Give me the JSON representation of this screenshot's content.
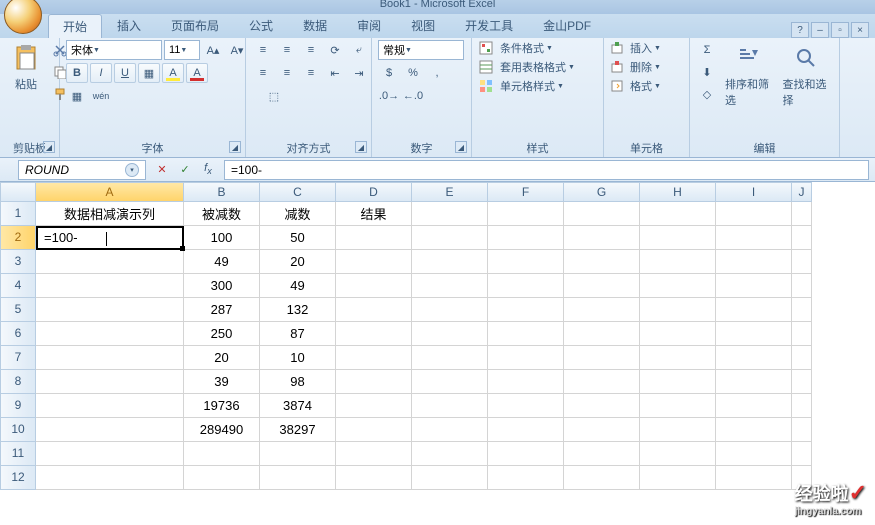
{
  "window_title": "Book1 - Microsoft Excel",
  "tabs": [
    "开始",
    "插入",
    "页面布局",
    "公式",
    "数据",
    "审阅",
    "视图",
    "开发工具",
    "金山PDF"
  ],
  "active_tab": 0,
  "groups": {
    "clipboard": "剪贴板",
    "paste": "粘贴",
    "font": "字体",
    "align": "对齐方式",
    "number": "数字",
    "styles": "样式",
    "cells": "单元格",
    "editing": "编辑"
  },
  "font": {
    "name": "宋体",
    "size": "11"
  },
  "number_format": "常规",
  "styles_btns": {
    "cond": "条件格式",
    "table": "套用表格格式",
    "cell": "单元格样式"
  },
  "cells_btns": {
    "insert": "插入",
    "delete": "删除",
    "format": "格式"
  },
  "editing_btns": {
    "sort": "排序和筛选",
    "find": "查找和选择"
  },
  "name_box": "ROUND",
  "formula": "=100-",
  "columns": [
    "A",
    "B",
    "C",
    "D",
    "E",
    "F",
    "G",
    "H",
    "I",
    "J"
  ],
  "rows_shown": [
    1,
    2,
    3,
    4,
    5,
    6,
    7,
    8,
    9,
    10,
    11,
    12
  ],
  "grid": {
    "1": {
      "A": "数据相减演示列",
      "B": "被减数",
      "C": "减数",
      "D": "结果"
    },
    "2": {
      "A": "=100-",
      "B": "100",
      "C": "50"
    },
    "3": {
      "B": "49",
      "C": "20"
    },
    "4": {
      "B": "300",
      "C": "49"
    },
    "5": {
      "B": "287",
      "C": "132"
    },
    "6": {
      "B": "250",
      "C": "87"
    },
    "7": {
      "B": "20",
      "C": "10"
    },
    "8": {
      "B": "39",
      "C": "98"
    },
    "9": {
      "B": "19736",
      "C": "3874"
    },
    "10": {
      "B": "289490",
      "C": "38297"
    }
  },
  "active_cell": {
    "row": 2,
    "col": "A"
  },
  "watermark": {
    "text": "经验啦",
    "site": "jingyanla.com"
  }
}
